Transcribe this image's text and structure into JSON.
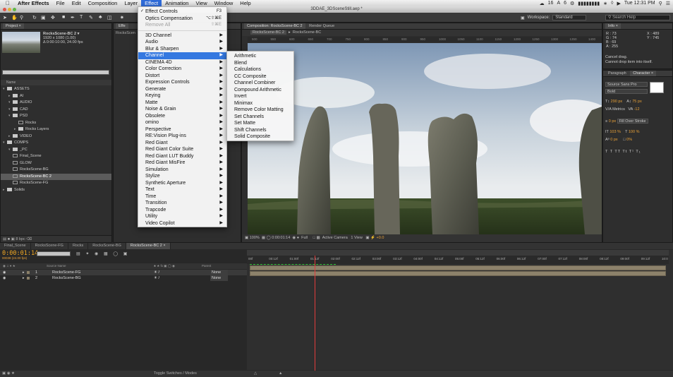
{
  "menubar": {
    "app_name": "After Effects",
    "items": [
      "File",
      "Edit",
      "Composition",
      "Layer",
      "Effect",
      "Animation",
      "View",
      "Window",
      "Help"
    ],
    "active_item": "Effect",
    "status_temp": "16",
    "status_clock": "Tue 12:31 PM",
    "status_num": "6"
  },
  "window": {
    "title": "3DDAE_3DSceneStill.aep *"
  },
  "toolbar": {
    "workspace_label": "Workspace:",
    "workspace_value": "Standard",
    "help_placeholder": "Search Help"
  },
  "project": {
    "tab": "Project ×",
    "comp_name": "RocksScene-BC 2 ▾",
    "comp_size": "1920 x 1080 (1.00)",
    "comp_duration": "Δ 0:00:10:00, 24.00 fps",
    "col_name": "Name",
    "tree": [
      {
        "label": "ASSETS",
        "indent": 0,
        "type": "folder",
        "open": true
      },
      {
        "label": "AI",
        "indent": 1,
        "type": "folder",
        "open": false
      },
      {
        "label": "AUDIO",
        "indent": 1,
        "type": "folder",
        "open": true
      },
      {
        "label": "CAD",
        "indent": 1,
        "type": "folder",
        "open": true
      },
      {
        "label": "PSD",
        "indent": 1,
        "type": "folder",
        "open": true
      },
      {
        "label": "Rocks",
        "indent": 2,
        "type": "comp",
        "open": false
      },
      {
        "label": "Rocks Layers",
        "indent": 2,
        "type": "folder",
        "open": false
      },
      {
        "label": "VIDEO",
        "indent": 1,
        "type": "folder",
        "open": false
      },
      {
        "label": "COMPS",
        "indent": 0,
        "type": "folder",
        "open": true
      },
      {
        "label": "_PC",
        "indent": 1,
        "type": "folder",
        "open": true
      },
      {
        "label": "Final_Scene",
        "indent": 1,
        "type": "comp",
        "open": false
      },
      {
        "label": "GLOW",
        "indent": 1,
        "type": "comp",
        "open": false
      },
      {
        "label": "RocksScene-BG",
        "indent": 1,
        "type": "comp",
        "open": false
      },
      {
        "label": "RocksScene-BC 2",
        "indent": 1,
        "type": "comp",
        "open": false,
        "selected": true
      },
      {
        "label": "RocksScene-FG",
        "indent": 1,
        "type": "comp",
        "open": false
      },
      {
        "label": "Solids",
        "indent": 0,
        "type": "folder",
        "open": false
      }
    ],
    "footer_bpc": "8 bpc"
  },
  "effect_panel": {
    "tab": "Effe",
    "sub": "RocksScen"
  },
  "composition": {
    "tab": "Composition: RocksScene-BC 2",
    "subtab_1": "RocksScene-BC 2",
    "subtab_2": "RocksScene-BC",
    "render_queue": "Render Queue",
    "ruler": [
      "500",
      "550",
      "600",
      "650",
      "700",
      "750",
      "800",
      "850",
      "900",
      "950",
      "1000",
      "1050",
      "1100",
      "1150",
      "1200",
      "1250",
      "1300",
      "1350",
      "1400"
    ],
    "zoom": "100%",
    "timecode": "0:00:01:14",
    "quality": "Full",
    "camera": "Active Camera",
    "view": "1 View",
    "exposure": "+0.0"
  },
  "info": {
    "tab": "Info ×",
    "r": "R : 73",
    "g": "G : 74",
    "b": "B : 69",
    "a": "A : 255",
    "x": "X : 489",
    "y": "Y : 745",
    "msg1": "Cancel drag.",
    "msg2": "Cannot drop item into itself."
  },
  "character": {
    "tab1": "Paragraph",
    "tab2": "Character ×",
    "font": "Source Sans Pro",
    "style": "Bold",
    "size": "290 px",
    "leading": "75 px",
    "kerning": "Metrics",
    "tracking": "-12",
    "stroke": "0 px",
    "stroke_mode": "Fill Over Stroke",
    "vscale": "103 %",
    "hscale": "100 %",
    "baseline": "0 px",
    "tsume": "0%",
    "styles": "T  T  TT  Tt  T¹  T₁"
  },
  "timeline": {
    "tabs": [
      "Final_Scene",
      "RocksScene-FG",
      "Rocks",
      "RocksScene-BG",
      "RocksScene-BC 2"
    ],
    "active_tab": "RocksScene-BC 2",
    "timecode": "0:00:01:14",
    "frames": "00038 (24.00 fps)",
    "col_source": "Source Name",
    "col_parent": "Parent",
    "layers": [
      {
        "num": "1",
        "name": "RocksScene-FG",
        "parent": "None"
      },
      {
        "num": "2",
        "name": "RocksScene-BG",
        "parent": "None"
      }
    ],
    "ruler": [
      "00f",
      "00:12f",
      "01:00f",
      "01:12f",
      "02:00f",
      "02:12f",
      "03:00f",
      "03:12f",
      "04:00f",
      "04:12f",
      "05:00f",
      "05:12f",
      "06:00f",
      "06:12f",
      "07:00f",
      "07:12f",
      "08:00f",
      "08:12f",
      "09:00f",
      "09:12f",
      "10:0"
    ],
    "footer": "Toggle Switches / Modes"
  },
  "effect_menu": {
    "items": [
      {
        "label": "Effect Controls",
        "shortcut": "F3",
        "check": true
      },
      {
        "label": "Optics Compensation",
        "shortcut": "⌥⇧⌘E"
      },
      {
        "label": "Remove All",
        "shortcut": "⇧⌘E",
        "disabled": true
      },
      {
        "sep": true
      },
      {
        "label": "3D Channel",
        "sub": true
      },
      {
        "label": "Audio",
        "sub": true
      },
      {
        "label": "Blur & Sharpen",
        "sub": true
      },
      {
        "label": "Channel",
        "sub": true,
        "highlight": true
      },
      {
        "label": "CINEMA 4D",
        "sub": true
      },
      {
        "label": "Color Correction",
        "sub": true
      },
      {
        "label": "Distort",
        "sub": true
      },
      {
        "label": "Expression Controls",
        "sub": true
      },
      {
        "label": "Generate",
        "sub": true
      },
      {
        "label": "Keying",
        "sub": true
      },
      {
        "label": "Matte",
        "sub": true
      },
      {
        "label": "Noise & Grain",
        "sub": true
      },
      {
        "label": "Obsolete",
        "sub": true
      },
      {
        "label": "omino",
        "sub": true
      },
      {
        "label": "Perspective",
        "sub": true
      },
      {
        "label": "RE:Vision Plug-ins",
        "sub": true
      },
      {
        "label": "Red Giant",
        "sub": true
      },
      {
        "label": "Red Giant Color Suite",
        "sub": true
      },
      {
        "label": "Red Giant LUT Buddy",
        "sub": true
      },
      {
        "label": "Red Giant MisFire",
        "sub": true
      },
      {
        "label": "Simulation",
        "sub": true
      },
      {
        "label": "Stylize",
        "sub": true
      },
      {
        "label": "Synthetic Aperture",
        "sub": true
      },
      {
        "label": "Text",
        "sub": true
      },
      {
        "label": "Time",
        "sub": true
      },
      {
        "label": "Transition",
        "sub": true
      },
      {
        "label": "Trapcode",
        "sub": true
      },
      {
        "label": "Utility",
        "sub": true
      },
      {
        "label": "Video Copilot",
        "sub": true
      }
    ]
  },
  "channel_menu": {
    "items": [
      "Arithmetic",
      "Blend",
      "Calculations",
      "CC Composite",
      "Channel Combiner",
      "Compound Arithmetic",
      "Invert",
      "Minimax",
      "Remove Color Matting",
      "Set Channels",
      "Set Matte",
      "Shift Channels",
      "Solid Composite"
    ]
  },
  "colors": {
    "menu_highlight": "#3478e0",
    "timecode": "#f2a823",
    "playhead": "#e23b3b",
    "layer_bar": "#8d826b"
  }
}
